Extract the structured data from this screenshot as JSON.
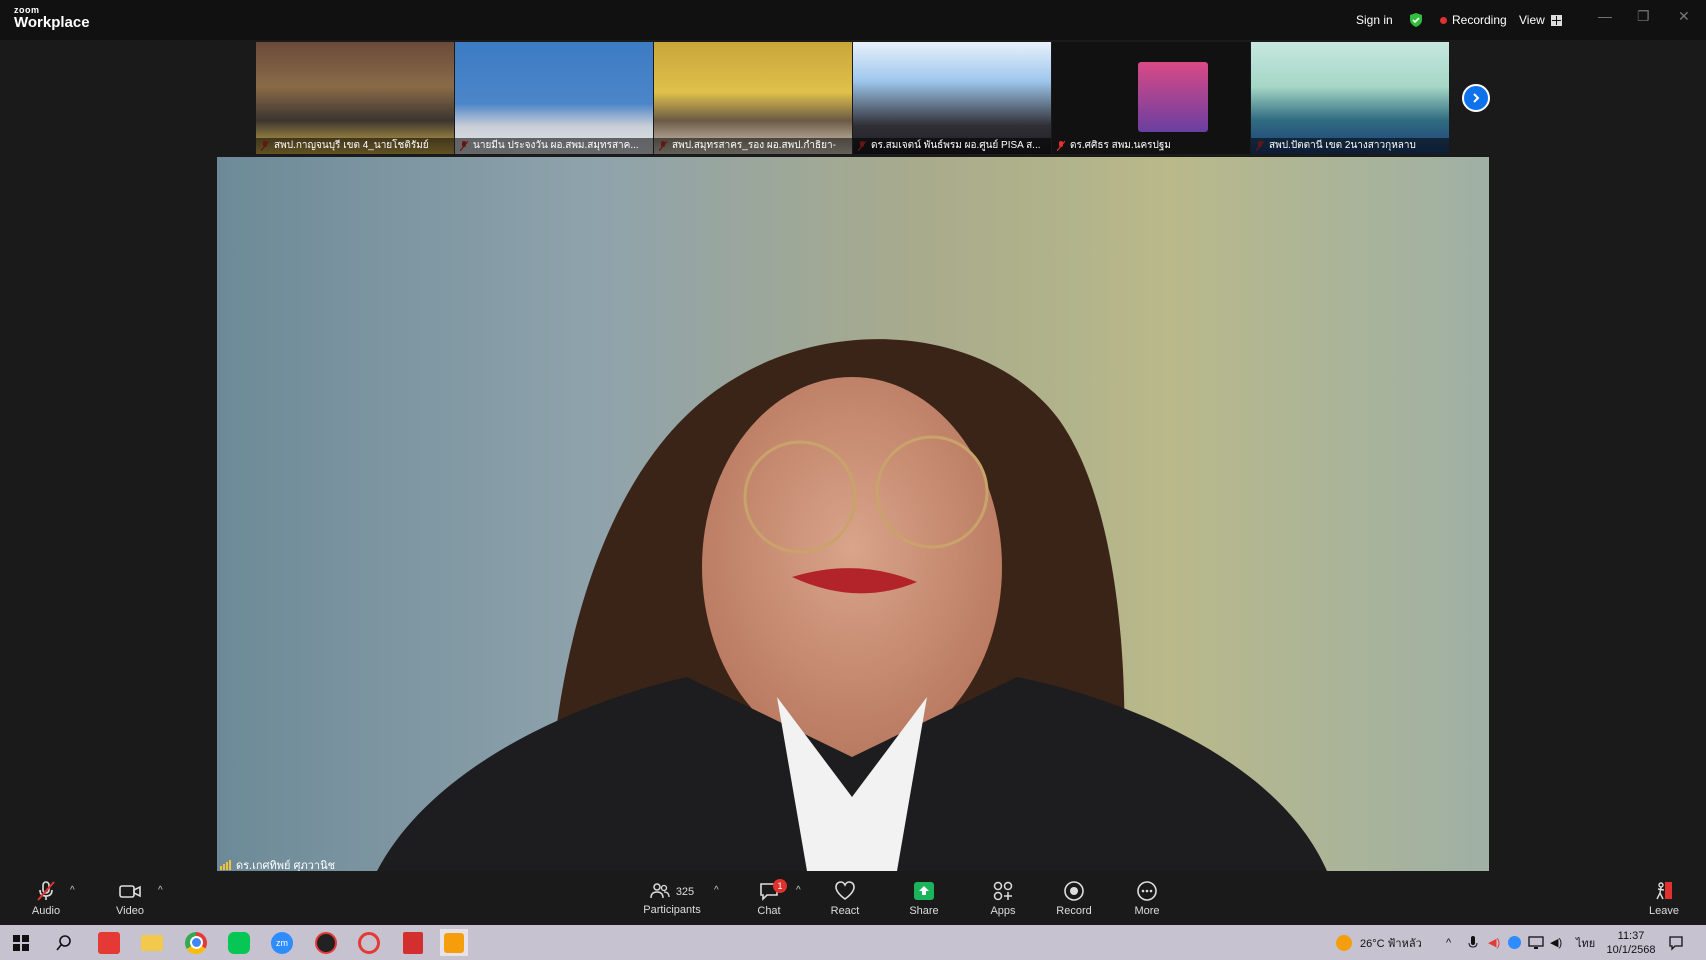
{
  "app": {
    "brand_small": "zoom",
    "brand_big": "Workplace"
  },
  "titlebar": {
    "sign_in": "Sign in",
    "recording": "Recording",
    "view": "View"
  },
  "thumbnails": [
    {
      "name": "สพป.กาญจนบุรี เขต 4_นายโชติรัมย์"
    },
    {
      "name": "นายมีน ประจงวัน ผอ.สพม.สมุทรสาค..."
    },
    {
      "name": "สพป.สมุทรสาคร_รอง ผอ.สพป.กำธิยา-"
    },
    {
      "name": "ดร.สมเจตน์ พันธ์พรม ผอ.ศูนย์ PISA ส..."
    },
    {
      "name": "ดร.ศศิธร สพม.นครปฐม"
    },
    {
      "name": "สพป.ปัตตานี เขต 2นางสาวกุหลาบ"
    }
  ],
  "main_speaker": {
    "name": "ดร.เกศทิพย์ ศุภวานิช"
  },
  "toolbar": {
    "audio": "Audio",
    "video": "Video",
    "participants": "Participants",
    "participants_count": "325",
    "chat": "Chat",
    "chat_badge": "1",
    "react": "React",
    "share": "Share",
    "apps": "Apps",
    "record": "Record",
    "more": "More",
    "leave": "Leave"
  },
  "taskbar": {
    "weather": "26°C  ฟ้าหลัว",
    "lang": "ไทย",
    "time": "11:37",
    "date": "10/1/2568"
  },
  "colors": {
    "accent": "#0e72ed",
    "share_green": "#1bb35b",
    "recording_red": "#e0312e"
  }
}
